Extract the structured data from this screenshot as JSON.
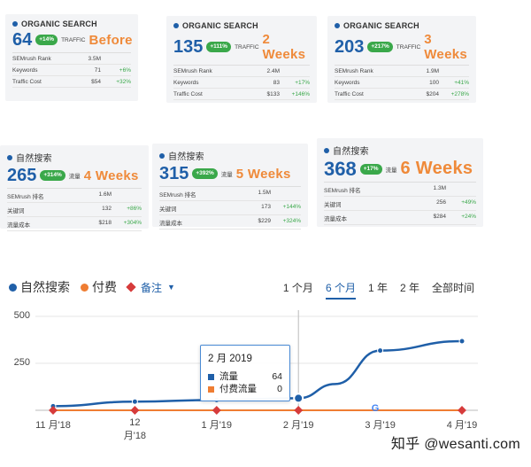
{
  "cards": [
    {
      "title": "ORGANIC SEARCH",
      "value": "64",
      "badge": "+14%",
      "traffic_label": "TRAFFIC",
      "when": "Before",
      "rows": [
        {
          "k": "SEMrush Rank",
          "v": "3.5M",
          "d": ""
        },
        {
          "k": "Keywords",
          "v": "71",
          "d": "+6%"
        },
        {
          "k": "Traffic Cost",
          "v": "$54",
          "d": "+32%"
        }
      ]
    },
    {
      "title": "ORGANIC SEARCH",
      "value": "135",
      "badge": "+111%",
      "traffic_label": "TRAFFIC",
      "when": "2 Weeks",
      "rows": [
        {
          "k": "SEMrush Rank",
          "v": "2.4M",
          "d": ""
        },
        {
          "k": "Keywords",
          "v": "83",
          "d": "+17%"
        },
        {
          "k": "Traffic Cost",
          "v": "$133",
          "d": "+146%"
        }
      ]
    },
    {
      "title": "ORGANIC SEARCH",
      "value": "203",
      "badge": "+217%",
      "traffic_label": "TRAFFIC",
      "when": "3 Weeks",
      "rows": [
        {
          "k": "SEMrush Rank",
          "v": "1.9M",
          "d": ""
        },
        {
          "k": "Keywords",
          "v": "100",
          "d": "+41%"
        },
        {
          "k": "Traffic Cost",
          "v": "$204",
          "d": "+278%"
        }
      ]
    },
    {
      "title": "自然搜索",
      "value": "265",
      "badge": "+314%",
      "traffic_label": "流量",
      "when": "4 Weeks",
      "rows": [
        {
          "k": "SEMrush 排名",
          "v": "1.6M",
          "d": ""
        },
        {
          "k": "关键词",
          "v": "132",
          "d": "+86%"
        },
        {
          "k": "流量成本",
          "v": "$218",
          "d": "+304%"
        }
      ]
    },
    {
      "title": "自然搜索",
      "value": "315",
      "badge": "+392%",
      "traffic_label": "流量",
      "when": "5 Weeks",
      "rows": [
        {
          "k": "SEMrush 排名",
          "v": "1.5M",
          "d": ""
        },
        {
          "k": "关键词",
          "v": "173",
          "d": "+144%"
        },
        {
          "k": "流量成本",
          "v": "$229",
          "d": "+324%"
        }
      ]
    },
    {
      "title": "自然搜索",
      "value": "368",
      "badge": "+17%",
      "traffic_label": "流量",
      "when": "6 Weeks",
      "rows": [
        {
          "k": "SEMrush 排名",
          "v": "1.3M",
          "d": ""
        },
        {
          "k": "关键词",
          "v": "256",
          "d": "+49%"
        },
        {
          "k": "流量成本",
          "v": "$284",
          "d": "+24%"
        }
      ]
    }
  ],
  "legend": {
    "organic": "自然搜索",
    "paid": "付费",
    "notes": "备注"
  },
  "ranges": [
    "1 个月",
    "6 个月",
    "1 年",
    "2 年",
    "全部时间"
  ],
  "active_range": "6 个月",
  "chart_data": {
    "type": "line",
    "x": [
      "11 月'18",
      "12 月'18",
      "1 月'19",
      "2 月'19",
      "3 月'19",
      "4 月'19"
    ],
    "yticks": [
      0,
      250,
      500
    ],
    "ylim": [
      0,
      500
    ],
    "series": [
      {
        "name": "流量",
        "color": "#1f5fa8",
        "points": [
          [
            0,
            22
          ],
          [
            1,
            46
          ],
          [
            2,
            55
          ],
          [
            3,
            64
          ],
          [
            3.45,
            140
          ],
          [
            4,
            318
          ],
          [
            5,
            368
          ]
        ]
      },
      {
        "name": "付费流量",
        "color": "#ef7d32",
        "points": [
          [
            0,
            0
          ],
          [
            1,
            0
          ],
          [
            2,
            0
          ],
          [
            3,
            0
          ],
          [
            4,
            0
          ],
          [
            5,
            0
          ]
        ]
      }
    ],
    "note_markers": [
      0,
      1,
      2,
      3,
      5
    ],
    "tooltip": {
      "title": "2 月 2019",
      "rows": [
        {
          "label": "流量",
          "value": "64"
        },
        {
          "label": "付费流量",
          "value": "0"
        }
      ]
    }
  },
  "colors": {
    "organic": "#1f5fa8",
    "paid": "#ef7d32",
    "note": "#d63b3b",
    "accent_orange": "#ef8a3a",
    "badge_green": "#3aa84a"
  },
  "watermark": "知乎 @wesanti.com"
}
